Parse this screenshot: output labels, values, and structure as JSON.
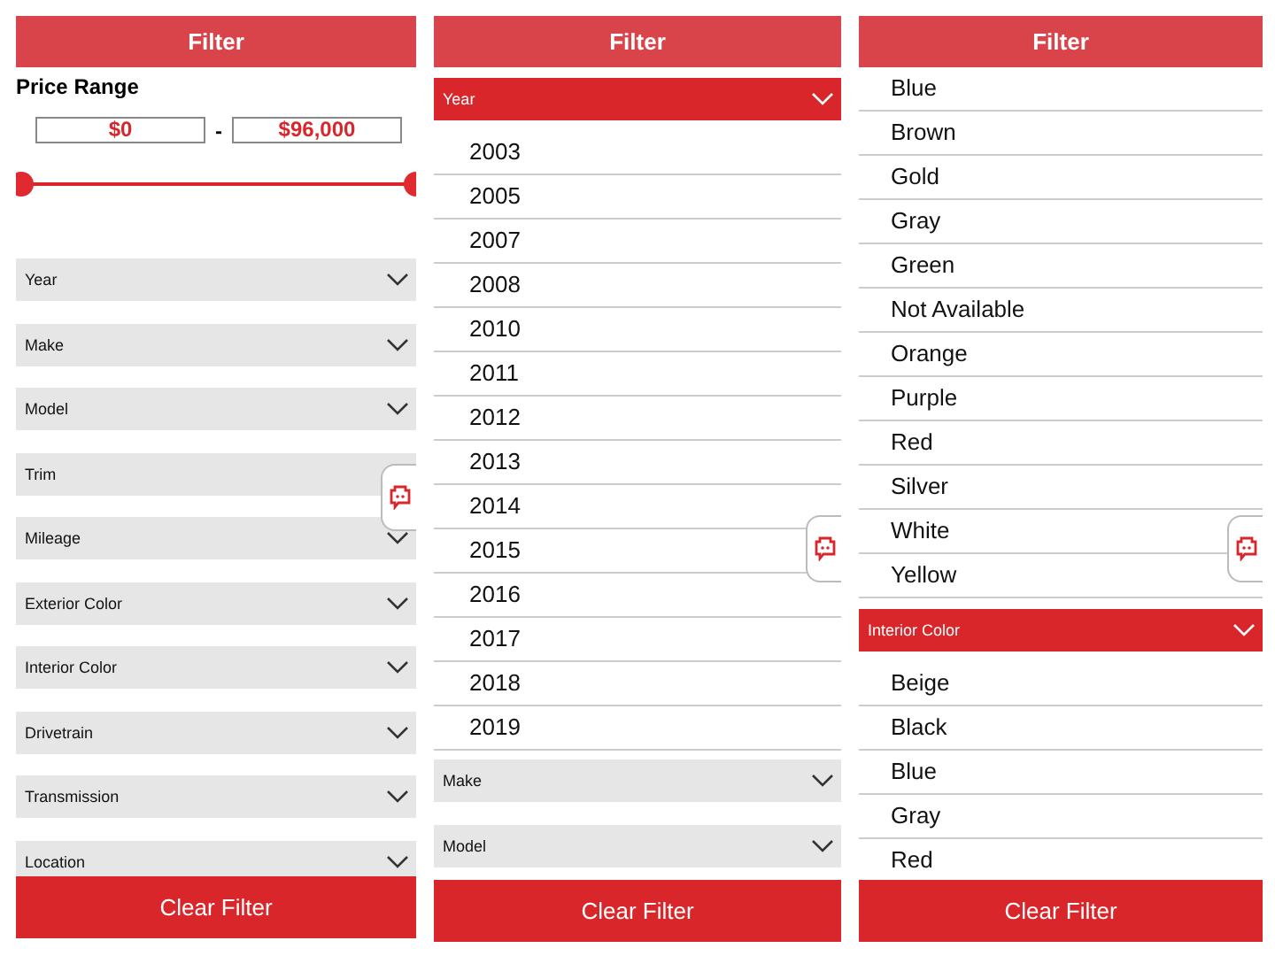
{
  "panels": [
    {
      "title": "Filter",
      "button": "Clear Filter",
      "chat_top": true,
      "items": [
        {
          "kind": "price",
          "label": "Price Range",
          "min": "$0",
          "separator": "-",
          "max": "$96,000",
          "level": 1
        },
        {
          "kind": "dropdown",
          "label": "Year",
          "expanded": false
        },
        {
          "kind": "dropdown",
          "label": "Make",
          "expanded": false
        },
        {
          "kind": "dropdown",
          "label": "Model",
          "expanded": false
        },
        {
          "kind": "dropdown",
          "label": "Trim",
          "expanded": false,
          "covered": true
        },
        {
          "kind": "dropdown",
          "label": "Mileage",
          "expanded": false
        },
        {
          "kind": "dropdown",
          "label": "Exterior Color",
          "expanded": false
        },
        {
          "kind": "dropdown",
          "label": "Interior Color",
          "expanded": false
        },
        {
          "kind": "dropdown",
          "label": "Drivetrain",
          "expanded": false
        },
        {
          "kind": "dropdown",
          "label": "Transmission",
          "expanded": false
        },
        {
          "kind": "dropdown",
          "label": "Location",
          "expanded": false
        }
      ]
    },
    {
      "title": "Filter",
      "button": "Clear Filter",
      "chat_top": false,
      "items": [
        {
          "kind": "dropdown",
          "label": "Year",
          "expanded": true
        },
        {
          "kind": "option",
          "label": "2003"
        },
        {
          "kind": "option",
          "label": "2005"
        },
        {
          "kind": "option",
          "label": "2007"
        },
        {
          "kind": "option",
          "label": "2008"
        },
        {
          "kind": "option",
          "label": "2010"
        },
        {
          "kind": "option",
          "label": "2011"
        },
        {
          "kind": "option",
          "label": "2012"
        },
        {
          "kind": "option",
          "label": "2013"
        },
        {
          "kind": "option",
          "label": "2014"
        },
        {
          "kind": "option",
          "label": "2015"
        },
        {
          "kind": "option",
          "label": "2016"
        },
        {
          "kind": "option",
          "label": "2017"
        },
        {
          "kind": "option",
          "label": "2018"
        },
        {
          "kind": "option",
          "label": "2019"
        },
        {
          "kind": "dropdown",
          "label": "Make",
          "expanded": false
        },
        {
          "kind": "dropdown",
          "label": "Model",
          "expanded": false
        }
      ]
    },
    {
      "title": "Filter",
      "button": "Clear Filter",
      "chat_top": false,
      "items": [
        {
          "kind": "option",
          "label": "Blue"
        },
        {
          "kind": "option",
          "label": "Brown"
        },
        {
          "kind": "option",
          "label": "Gold"
        },
        {
          "kind": "option",
          "label": "Gray"
        },
        {
          "kind": "option",
          "label": "Green"
        },
        {
          "kind": "option",
          "label": "Not Available"
        },
        {
          "kind": "option",
          "label": "Orange"
        },
        {
          "kind": "option",
          "label": "Purple"
        },
        {
          "kind": "option",
          "label": "Red"
        },
        {
          "kind": "option",
          "label": "Silver"
        },
        {
          "kind": "option",
          "label": "White"
        },
        {
          "kind": "option",
          "label": "Yellow"
        },
        {
          "kind": "dropdown",
          "label": "Interior Color",
          "expanded": true
        },
        {
          "kind": "option",
          "label": "Beige"
        },
        {
          "kind": "option",
          "label": "Black"
        },
        {
          "kind": "option",
          "label": "Blue"
        },
        {
          "kind": "option",
          "label": "Gray"
        },
        {
          "kind": "option",
          "label": "Red"
        }
      ]
    }
  ]
}
